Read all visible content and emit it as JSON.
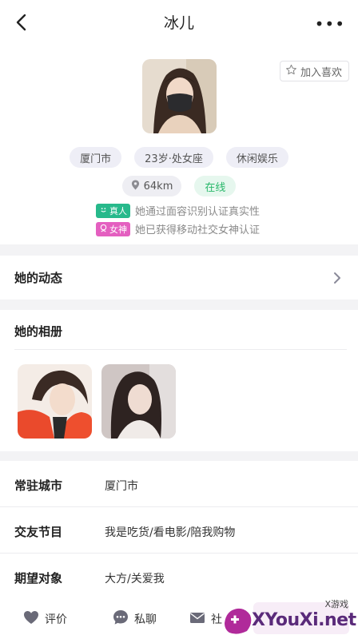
{
  "header": {
    "title": "冰儿",
    "more_glyph": "•••"
  },
  "profile": {
    "favorite_label": "加入喜欢",
    "tags": [
      "厦门市",
      "23岁·处女座",
      "休闲娱乐"
    ],
    "distance": "64km",
    "online": "在线",
    "verifications": [
      {
        "badge": "真人",
        "text": "她通过面容识别认证真实性",
        "color": "#27b98b"
      },
      {
        "badge": "女神",
        "text": "她已获得移动社交女神认证",
        "color": "#e45fc0"
      }
    ]
  },
  "dynamics": {
    "label": "她的动态"
  },
  "album": {
    "label": "她的相册"
  },
  "info": [
    {
      "key": "常驻城市",
      "value": "厦门市"
    },
    {
      "key": "交友节目",
      "value": "我是吃货/看电影/陪我购物"
    },
    {
      "key": "期望对象",
      "value": "大方/关爱我"
    }
  ],
  "bottom_bar": {
    "rate": "评价",
    "chat": "私聊",
    "social": "社"
  },
  "watermark": {
    "text": "XYouXi.net",
    "small": "X游戏"
  }
}
